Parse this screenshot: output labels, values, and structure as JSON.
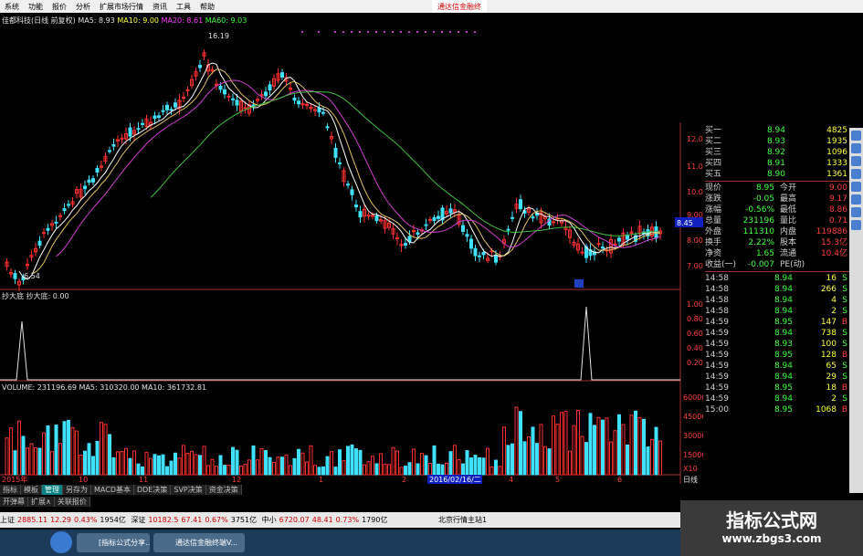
{
  "menu": [
    "系统",
    "功能",
    "报价",
    "分析",
    "扩展市场行情",
    "资讯",
    "工具",
    "帮助"
  ],
  "brand": "通达信金融终",
  "title": {
    "name": "佳都科技(日线 前复权)",
    "ma5": "MA5: 8.93",
    "ma10": "MA10: 9.00",
    "ma20": "MA20: 8.61",
    "ma60": "MA60: 9.03"
  },
  "price_axis": [
    "12.00",
    "11.00",
    "10.00",
    "9.00",
    "8.00",
    "7.00"
  ],
  "price_current": "8.45",
  "high_label": "16.19",
  "low_label": "6.54",
  "ind_label": "抄大底 抄大底: 0.00",
  "ind_axis": [
    "1.00",
    "0.80",
    "0.60",
    "0.40",
    "0.20"
  ],
  "vol_label": "VOLUME: 231196.69 MA5: 310320.00 MA10: 361732.81",
  "vol_axis": [
    "60000",
    "45000",
    "30000",
    "15000",
    "X10"
  ],
  "date_axis": [
    "2015年",
    "10",
    "11",
    "12",
    "1",
    "2",
    "3",
    "4",
    "5",
    "6"
  ],
  "date_highlight": "2016/02/16/二",
  "period": "日线",
  "quote": {
    "bids": [
      [
        "买一",
        "8.94",
        "4825"
      ],
      [
        "买二",
        "8.93",
        "1935"
      ],
      [
        "买三",
        "8.92",
        "1096"
      ],
      [
        "买四",
        "8.91",
        "1333"
      ],
      [
        "买五",
        "8.90",
        "1361"
      ]
    ],
    "stats": [
      [
        "现价",
        "8.95",
        "今开",
        "9.00"
      ],
      [
        "涨跌",
        "-0.05",
        "最高",
        "9.17"
      ],
      [
        "涨幅",
        "-0.56%",
        "最低",
        "8.86"
      ],
      [
        "总量",
        "231196",
        "量比",
        "0.71"
      ],
      [
        "外盘",
        "111310",
        "内盘",
        "119886"
      ],
      [
        "换手",
        "2.22%",
        "股本",
        "15.3亿"
      ],
      [
        "净资",
        "1.65",
        "流通",
        "10.4亿"
      ],
      [
        "收益(一)",
        "-0.007",
        "PE(动)",
        ""
      ]
    ],
    "ticks": [
      [
        "14:58",
        "8.94",
        "16",
        "S"
      ],
      [
        "14:58",
        "8.94",
        "266",
        "S"
      ],
      [
        "14:58",
        "8.94",
        "4",
        "S"
      ],
      [
        "14:58",
        "8.94",
        "2",
        "S"
      ],
      [
        "14:59",
        "8.95",
        "147",
        "B"
      ],
      [
        "14:59",
        "8.94",
        "738",
        "S"
      ],
      [
        "14:59",
        "8.93",
        "100",
        "S"
      ],
      [
        "14:59",
        "8.95",
        "128",
        "B"
      ],
      [
        "14:59",
        "8.94",
        "65",
        "S"
      ],
      [
        "14:59",
        "8.94",
        "29",
        "S"
      ],
      [
        "14:59",
        "8.95",
        "18",
        "B"
      ],
      [
        "14:59",
        "8.94",
        "2",
        "S"
      ],
      [
        "15:00",
        "8.95",
        "1068",
        "B"
      ]
    ]
  },
  "bottom_tabs_1": [
    "指标",
    "模板",
    "管理",
    "另存为",
    "MACD基本",
    "DDE决策",
    "SVP决策",
    "资金决策"
  ],
  "bottom_tabs_2": [
    "开弹幕",
    "扩展∧",
    "关联报价"
  ],
  "status": [
    "上证",
    "2885.11",
    "12.29",
    "0.43%",
    "1954亿",
    "深证",
    "10182.5",
    "67.41",
    "0.67%",
    "3751亿",
    "中小",
    "6720.07",
    "48.41",
    "0.73%",
    "1790亿",
    "北京行情主站1"
  ],
  "taskbar": [
    "[指标公式分享...",
    "通达信金融终端V..."
  ],
  "watermark": {
    "line1": "指标公式网",
    "line2": "www.zbgs3.com"
  },
  "colors": {
    "up": "#ff3030",
    "down": "#40e0ff",
    "ma5": "#ffffff",
    "ma10": "#e0c060",
    "ma20": "#d040d0",
    "ma60": "#40c040",
    "bg": "#000000"
  }
}
